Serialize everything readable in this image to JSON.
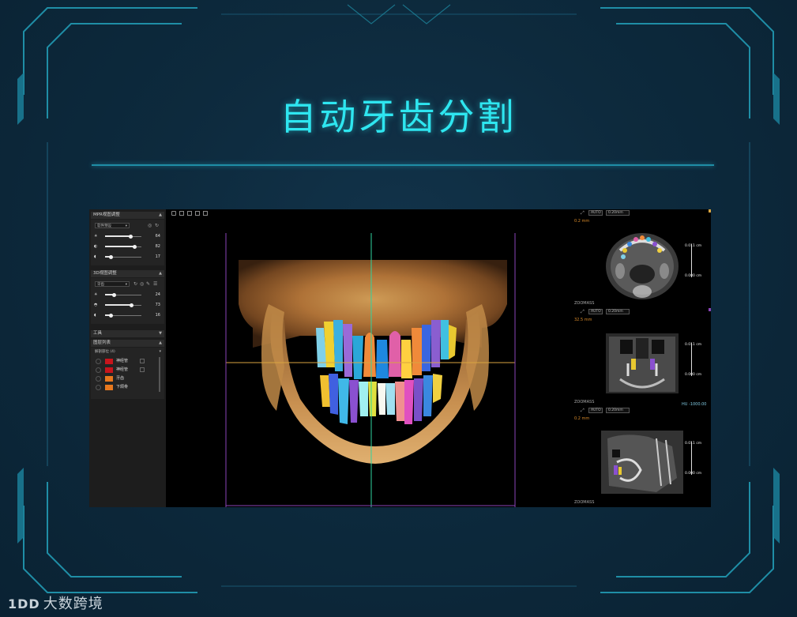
{
  "page": {
    "title": "自动牙齿分割",
    "watermark_logo": "1DD",
    "watermark_text": "大数跨境"
  },
  "left_panel": {
    "mpr_section": {
      "header": "MPR视图调整",
      "preset": "软件预设",
      "sliders": [
        {
          "icon": "brightness-icon",
          "value": "64",
          "level": 0.7
        },
        {
          "icon": "contrast-icon",
          "value": "82",
          "level": 0.82
        },
        {
          "icon": "half-moon-icon",
          "value": "17",
          "level": 0.17
        }
      ]
    },
    "view3d_section": {
      "header": "3D视图调整",
      "preset": "牙齿",
      "sliders": [
        {
          "icon": "brightness-icon",
          "value": "24",
          "level": 0.24
        },
        {
          "icon": "contrast-icon",
          "value": "73",
          "level": 0.73
        },
        {
          "icon": "half-moon-icon",
          "value": "16",
          "level": 0.16
        }
      ]
    },
    "tools_section": {
      "header": "工具"
    },
    "layers_section": {
      "header": "图层列表",
      "group": "解剖部位 (4)",
      "items": [
        {
          "name": "神经管",
          "color": "#c8151c"
        },
        {
          "name": "神经管",
          "color": "#c8151c"
        },
        {
          "name": "牙齿",
          "color": "#e8781e"
        },
        {
          "name": "下颌骨",
          "color": "#e8781e"
        }
      ]
    }
  },
  "right_panel": {
    "views": [
      {
        "zoom": "AUTO",
        "thickness": "0.20mm",
        "top_value": "0.2 mm",
        "bottom_label": "ZOOMASS",
        "scale_top": "0.011 cm",
        "scale_bottom": "0.000 cm",
        "corner": ""
      },
      {
        "zoom": "AUTO",
        "thickness": "0.20mm",
        "top_value": "32.5 mm",
        "bottom_label": "ZOOMASS",
        "scale_top": "0.011 cm",
        "scale_bottom": "0.000 cm",
        "corner": ""
      },
      {
        "zoom": "AUTO",
        "thickness": "0.20mm",
        "top_value": "0.2 mm",
        "bottom_label": "ZOOMASS",
        "scale_top": "0.011 cm",
        "scale_bottom": "0.000 cm",
        "corner": "HU -1000.00"
      }
    ]
  },
  "colors": {
    "title": "#2ee6f0",
    "frame": "#1f8ea6",
    "accent_orange": "#d98a2a",
    "crosshair_green": "#2fd5a0",
    "crosshair_orange": "#d9a540",
    "frame_purple": "#8a44b8"
  }
}
